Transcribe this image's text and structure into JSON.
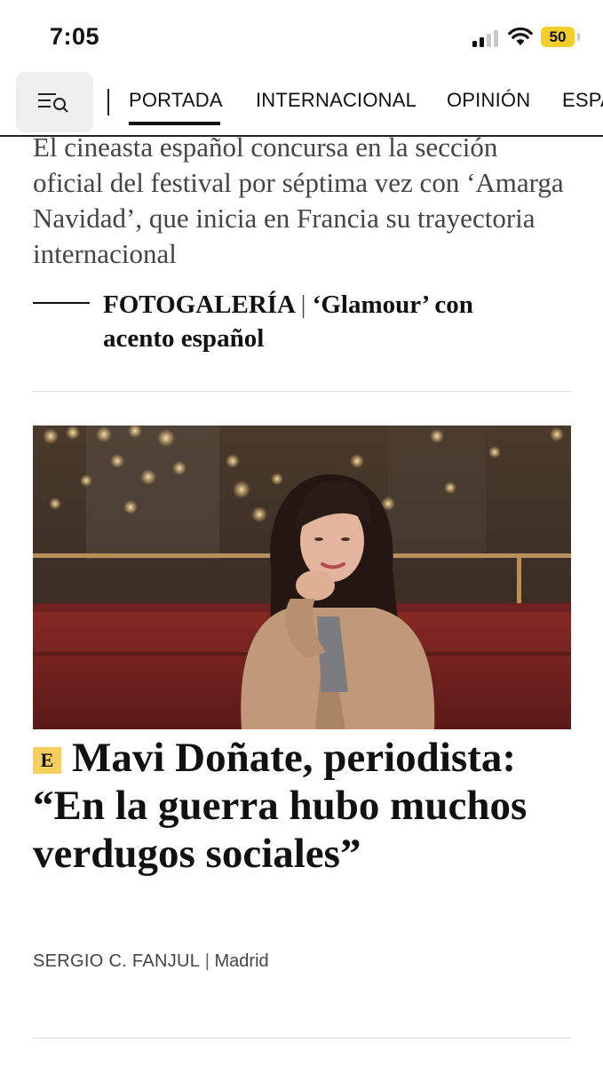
{
  "status_bar": {
    "time": "7:05",
    "battery": "50"
  },
  "nav": {
    "tabs": [
      {
        "label": "PORTADA",
        "active": true
      },
      {
        "label": "INTERNACIONAL",
        "active": false
      },
      {
        "label": "OPINIÓN",
        "active": false
      },
      {
        "label": "ESPA",
        "active": false
      }
    ]
  },
  "article_top": {
    "summary": "El cineasta español concursa en la sección oficial del festival por séptima vez con ‘Amarga Navidad’, que inicia en Francia su trayectoria internacional",
    "related_section": "FOTOGALERÍA",
    "related_separator": "|",
    "related_title": "‘Glamour’ con acento español"
  },
  "article_main": {
    "badge": "E",
    "headline": "Mavi Doñate, periodista: “En la guerra hubo muchos verdugos sociales”",
    "author": "SERGIO C. FANJUL",
    "byline_separator": "|",
    "location": "Madrid"
  },
  "colors": {
    "accent_yellow": "#f4cf5c",
    "battery_yellow": "#f4cf2c",
    "text": "#111111",
    "muted_text": "#444444"
  }
}
